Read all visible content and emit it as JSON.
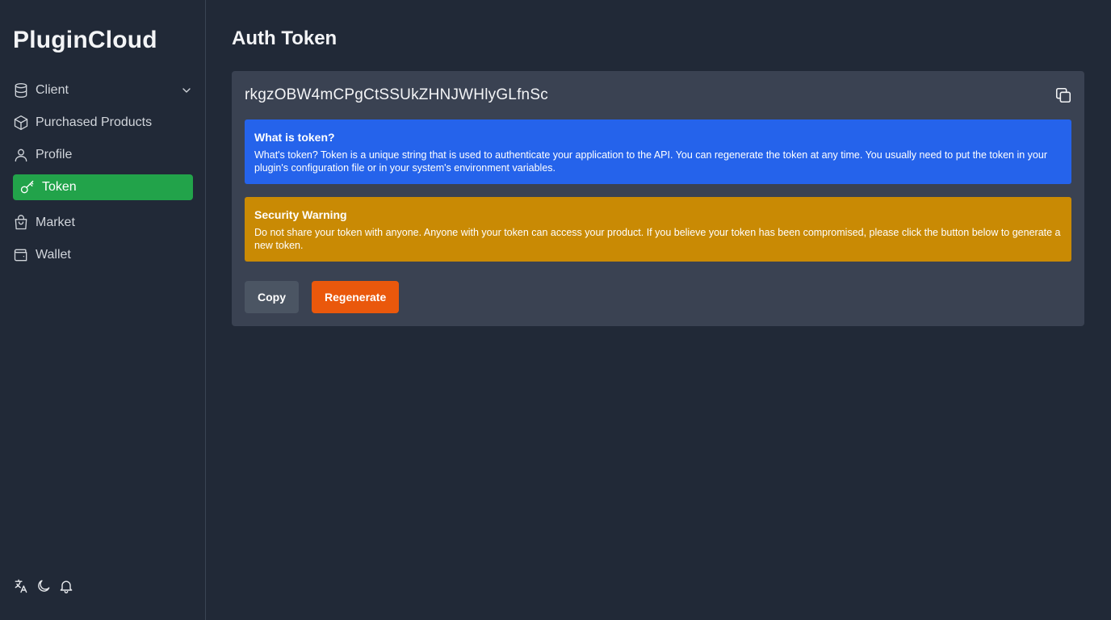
{
  "app": {
    "title": "PluginCloud"
  },
  "sidebar": {
    "items": [
      {
        "label": "Client",
        "icon": "database-icon",
        "has_submenu": true,
        "active": false
      },
      {
        "label": "Purchased Products",
        "icon": "package-icon",
        "active": false
      },
      {
        "label": "Profile",
        "icon": "user-icon",
        "active": false
      },
      {
        "label": "Token",
        "icon": "key-icon",
        "active": true
      },
      {
        "label": "Market",
        "icon": "shopping-bag-icon",
        "active": false
      },
      {
        "label": "Wallet",
        "icon": "wallet-icon",
        "active": false
      }
    ],
    "footer_icons": [
      "translate-icon",
      "moon-icon",
      "bell-icon"
    ]
  },
  "main": {
    "title": "Auth Token",
    "token": "rkgzOBW4mCPgCtSSUkZHNJWHlyGLfnSc",
    "info": {
      "title": "What is token?",
      "body": "What's token? Token is a unique string that is used to authenticate your application to the API. You can regenerate the token at any time. You usually need to put the token in your plugin's configuration file or in your system's environment variables."
    },
    "warning": {
      "title": "Security Warning",
      "body": "Do not share your token with anyone. Anyone with your token can access your product. If you believe your token has been compromised, please click the button below to generate a new token."
    },
    "actions": {
      "copy": "Copy",
      "regenerate": "Regenerate"
    }
  },
  "colors": {
    "background": "#212937",
    "card": "#3a4252",
    "active_nav": "#22a34a",
    "info": "#2563eb",
    "warning": "#c98a04",
    "primary_button": "#ea580c",
    "secondary_button": "#4b5563"
  }
}
